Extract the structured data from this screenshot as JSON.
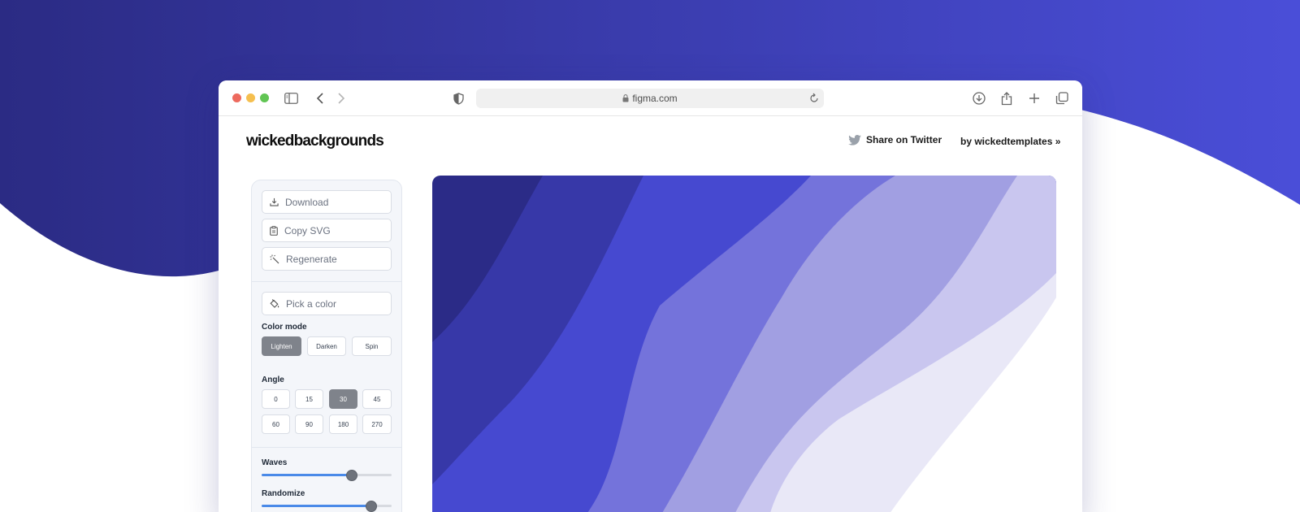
{
  "colors": {
    "bg_start": "#2b2b84",
    "bg_end": "#4a4ed8",
    "waves": [
      "#2b2b87",
      "#3738a8",
      "#4649d0",
      "#7473db",
      "#a19fe2",
      "#c9c6ef",
      "#e9e8f7",
      "#ffffff"
    ]
  },
  "browser": {
    "url": "figma.com",
    "icons": [
      "sidebar-icon",
      "back-icon",
      "forward-icon",
      "shield-icon",
      "lock-icon",
      "reload-icon",
      "download-icon",
      "share-icon",
      "plus-icon",
      "tabs-icon"
    ]
  },
  "site": {
    "logo": "wickedbackgrounds",
    "share_label": "Share on Twitter",
    "by_label": "by wickedtemplates »"
  },
  "panel": {
    "download_label": "Download",
    "copy_svg_label": "Copy SVG",
    "regenerate_label": "Regenerate",
    "pick_color_placeholder": "Pick a color",
    "color_mode_label": "Color mode",
    "color_modes": [
      "Lighten",
      "Darken",
      "Spin"
    ],
    "color_mode_selected": "Lighten",
    "angle_label": "Angle",
    "angles": [
      "0",
      "15",
      "30",
      "45",
      "60",
      "90",
      "180",
      "270"
    ],
    "angle_selected": "30",
    "waves_label": "Waves",
    "waves_level": 0.71,
    "randomize_label": "Randomize",
    "randomize_level": 0.88
  }
}
